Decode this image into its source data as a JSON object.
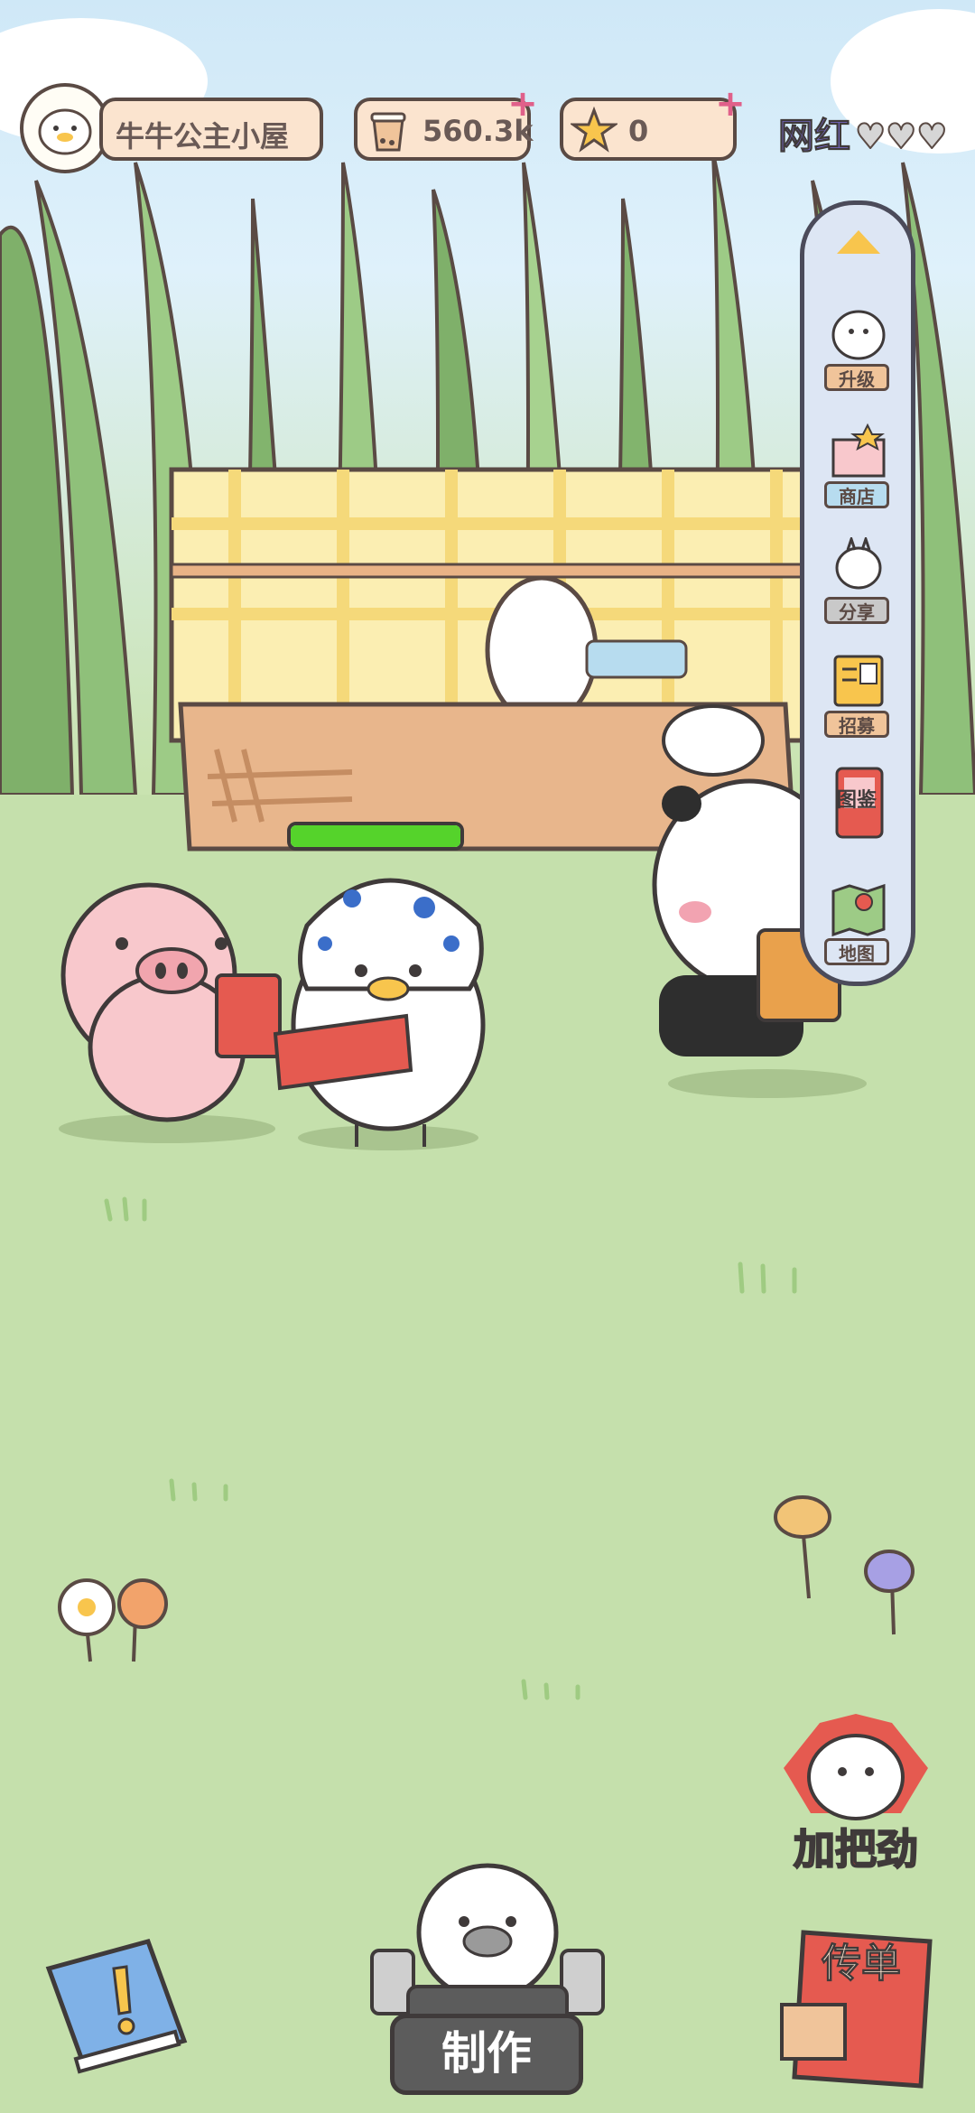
{
  "shop": {
    "name": "牛牛公主小屋"
  },
  "currency": {
    "tea_amount": "560.3k",
    "star_amount": "0"
  },
  "rating": {
    "label": "网红",
    "hearts": 3
  },
  "side_menu": [
    {
      "label": "升级",
      "icon": "ghost-upgrade-icon"
    },
    {
      "label": "商店",
      "icon": "shop-icon"
    },
    {
      "label": "分享",
      "icon": "share-icon"
    },
    {
      "label": "招募",
      "icon": "recruit-icon"
    },
    {
      "label": "图鉴",
      "icon": "book-icon"
    },
    {
      "label": "地图",
      "icon": "map-icon"
    }
  ],
  "buttons": {
    "cheer": "加把劲",
    "make": "制作",
    "flyer": "传单"
  },
  "progress": {
    "fill_fraction": 1.0
  },
  "colors": {
    "grass": "#c5e0ac",
    "accent_red": "#e0453a",
    "bar_green": "#55d32b"
  }
}
